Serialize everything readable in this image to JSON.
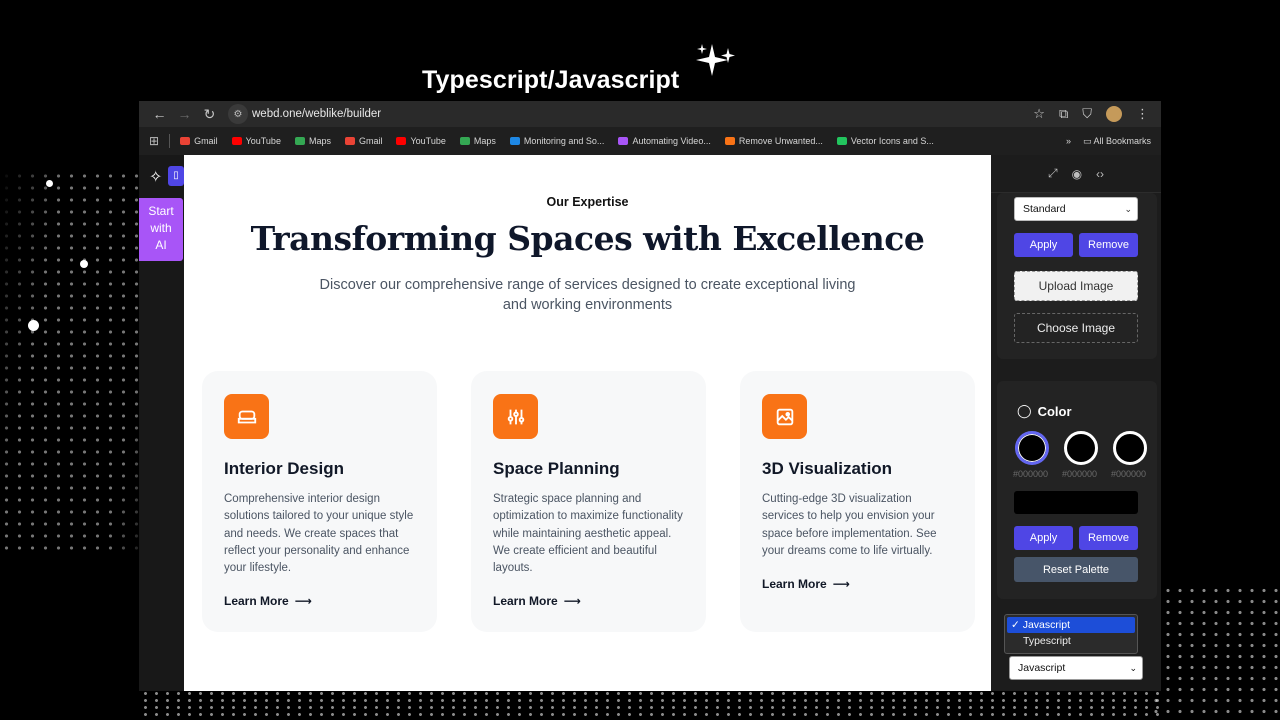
{
  "overlay": {
    "headline": "Typescript/Javascript",
    "sparkle_icon": "sparkle-icon"
  },
  "browser": {
    "url": "webd.one/weblike/builder",
    "bookmarks": [
      {
        "label": "Gmail",
        "color": "#ea4335"
      },
      {
        "label": "YouTube",
        "color": "#ff0000"
      },
      {
        "label": "Maps",
        "color": "#34a853"
      },
      {
        "label": "Gmail",
        "color": "#ea4335"
      },
      {
        "label": "YouTube",
        "color": "#ff0000"
      },
      {
        "label": "Maps",
        "color": "#34a853"
      },
      {
        "label": "Monitoring and So...",
        "color": "#1e88e5"
      },
      {
        "label": "Automating Video...",
        "color": "#a855f7"
      },
      {
        "label": "Remove Unwanted...",
        "color": "#f97316"
      },
      {
        "label": "Vector Icons and S...",
        "color": "#22c55e"
      }
    ],
    "all_bookmarks": "All Bookmarks"
  },
  "sidebar": {
    "ai_button": "Start with AI"
  },
  "page": {
    "eyebrow": "Our Expertise",
    "title": "Transforming Spaces with Excellence",
    "subtitle": "Discover our comprehensive range of services designed to create exceptional living and working environments",
    "accent_color": "#f97316",
    "cards": [
      {
        "title": "Interior Design",
        "text": "Comprehensive interior design solutions tailored to your unique style and needs. We create spaces that reflect your personality and enhance your lifestyle.",
        "link": "Learn More",
        "icon": "sofa-icon"
      },
      {
        "title": "Space Planning",
        "text": "Strategic space planning and optimization to maximize functionality while maintaining aesthetic appeal. We create efficient and beautiful layouts.",
        "link": "Learn More",
        "icon": "sliders-icon"
      },
      {
        "title": "3D Visualization",
        "text": "Cutting-edge 3D visualization services to help you envision your space before implementation. See your dreams come to life virtually.",
        "link": "Learn More",
        "icon": "image-icon"
      }
    ]
  },
  "panel": {
    "image_mode": "Standard",
    "apply": "Apply",
    "remove": "Remove",
    "upload_image": "Upload Image",
    "choose_image": "Choose Image",
    "color_heading": "Color",
    "swatches": [
      "#000000",
      "#000000",
      "#000000"
    ],
    "color_apply": "Apply",
    "color_remove": "Remove",
    "reset_palette": "Reset Palette",
    "language_options": [
      "Javascript",
      "Typescript"
    ],
    "language_selected": "Javascript"
  }
}
